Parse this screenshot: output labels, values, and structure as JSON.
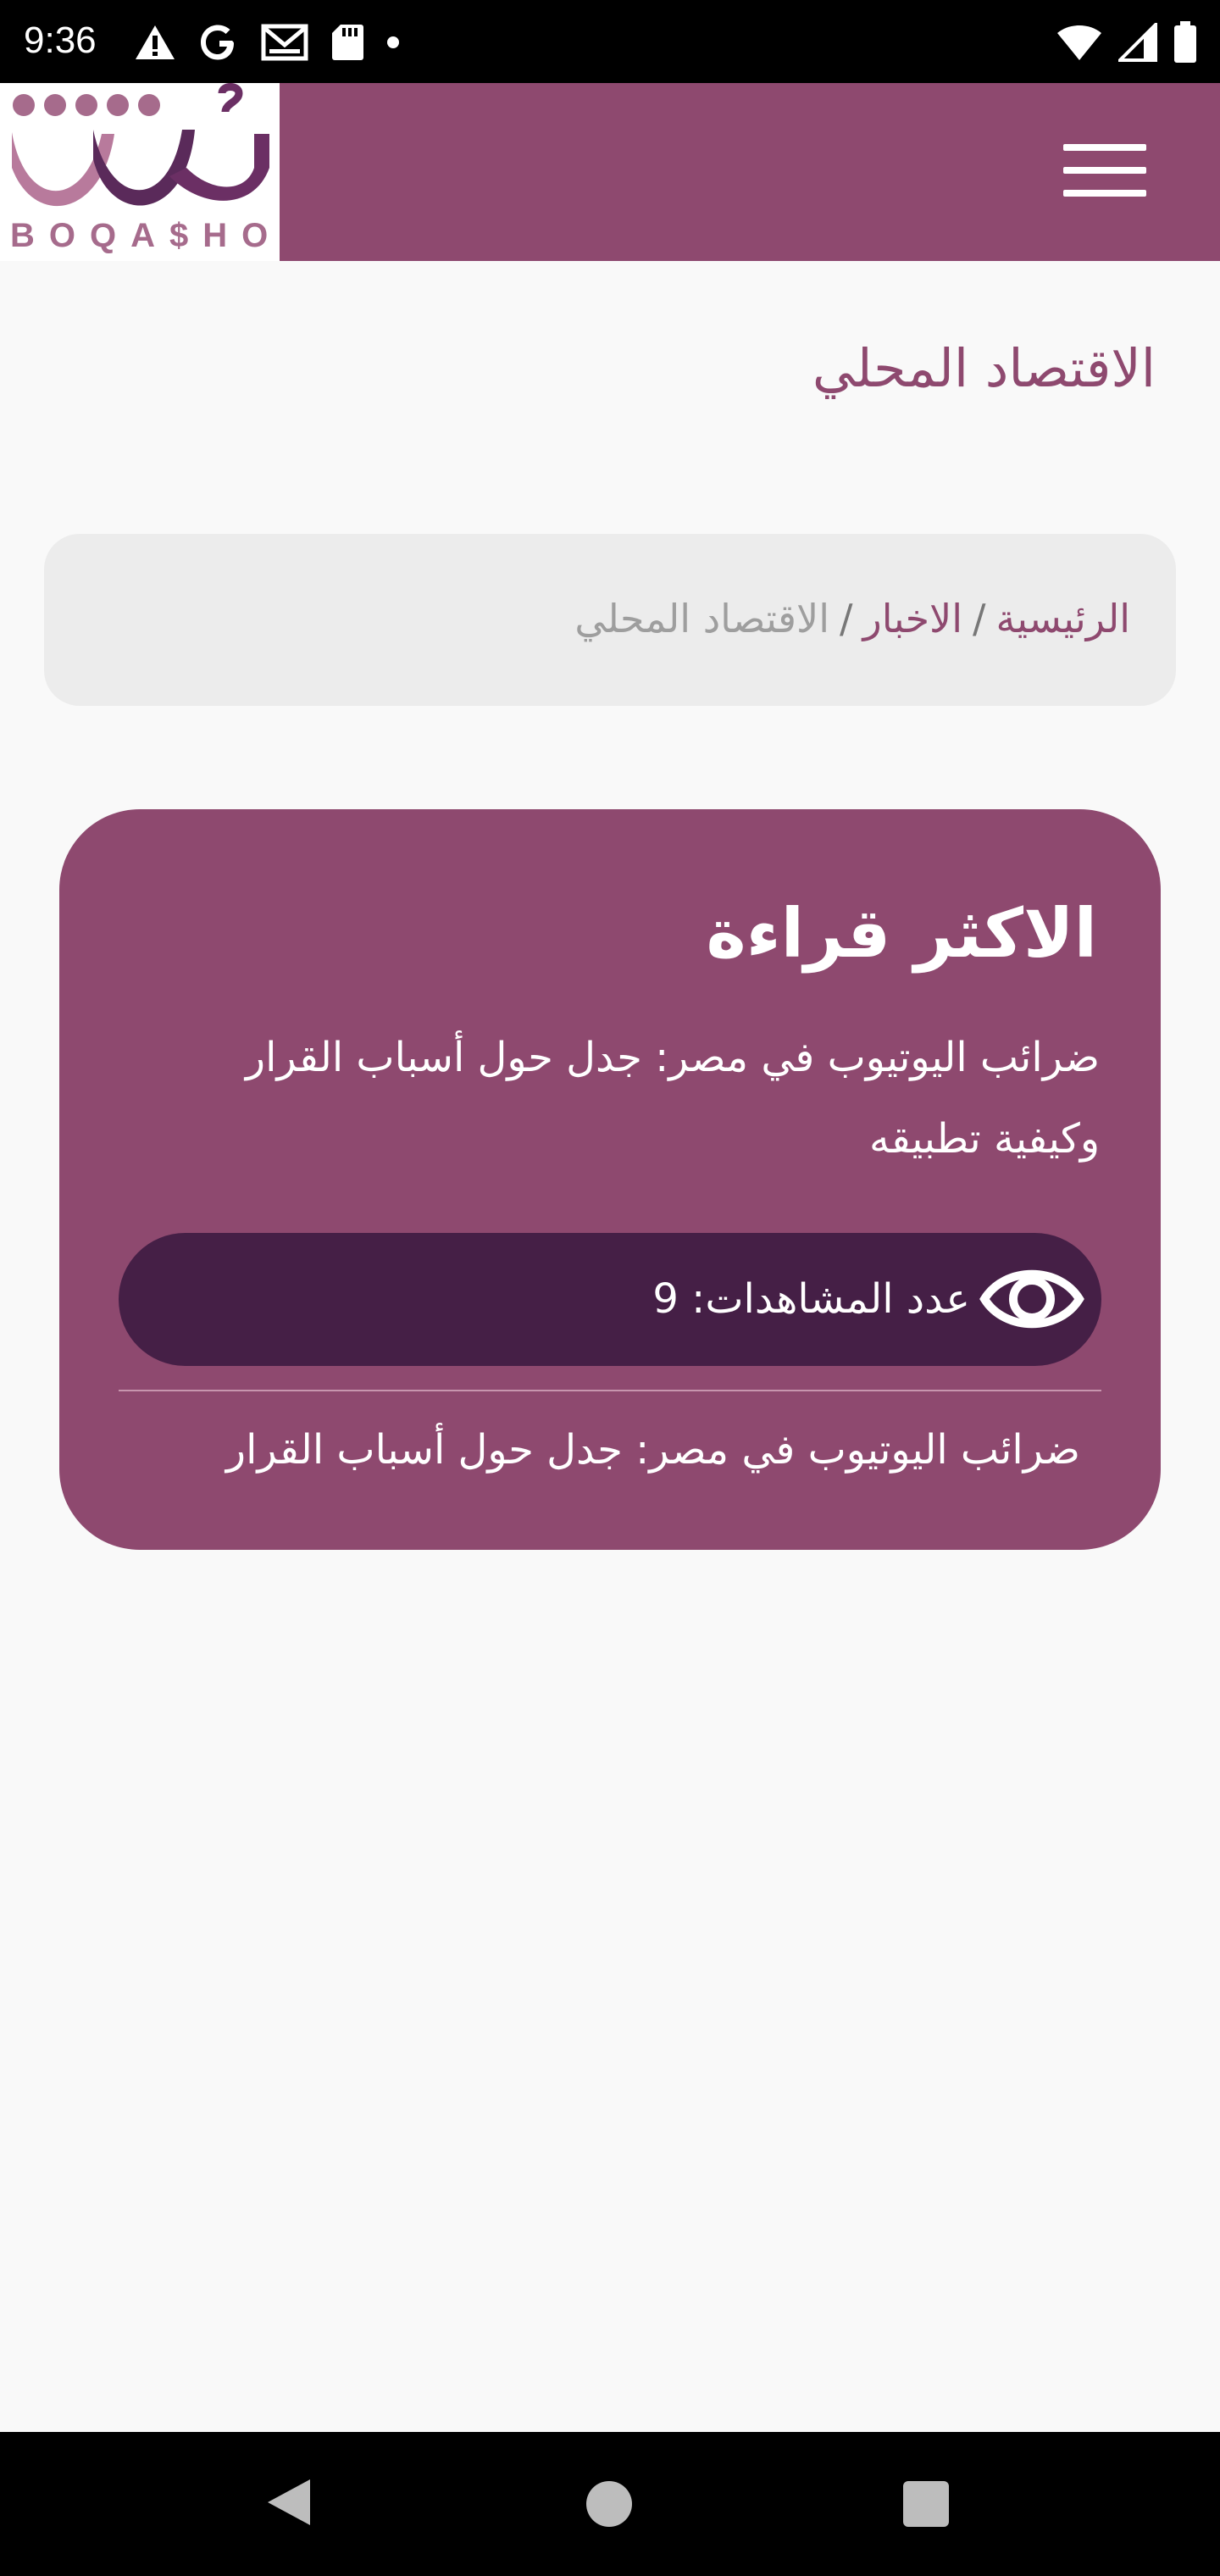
{
  "status_bar": {
    "time": "9:36",
    "left_icons": [
      "warning-icon",
      "google-icon",
      "gmail-icon",
      "sd-card-icon",
      "dot-icon"
    ],
    "right_icons": [
      "wifi-icon",
      "signal-icon",
      "battery-icon"
    ]
  },
  "header": {
    "logo_text": "BOQA$HO",
    "brand_color": "#8e496f",
    "menu_icon": "hamburger-menu-icon"
  },
  "page": {
    "title": "الاقتصاد المحلي"
  },
  "breadcrumb": {
    "home": "الرئيسية",
    "separator": "/",
    "news": "الاخبار",
    "current": "الاقتصاد المحلي"
  },
  "most_read": {
    "heading": "الاكثر قراءة",
    "article_title": "ضرائب اليوتيوب في مصر: جدل حول أسباب القرار وكيفية تطبيقه",
    "views_label": "عدد المشاهدات:",
    "views_count": "9",
    "views_icon": "eye-icon",
    "next_article_title": "ضرائب اليوتيوب في مصر: جدل حول أسباب القرار",
    "card_color": "#8e496f",
    "pill_color": "#451f46"
  },
  "nav_bar": {
    "buttons": [
      "back-icon",
      "home-icon",
      "recents-icon"
    ]
  }
}
